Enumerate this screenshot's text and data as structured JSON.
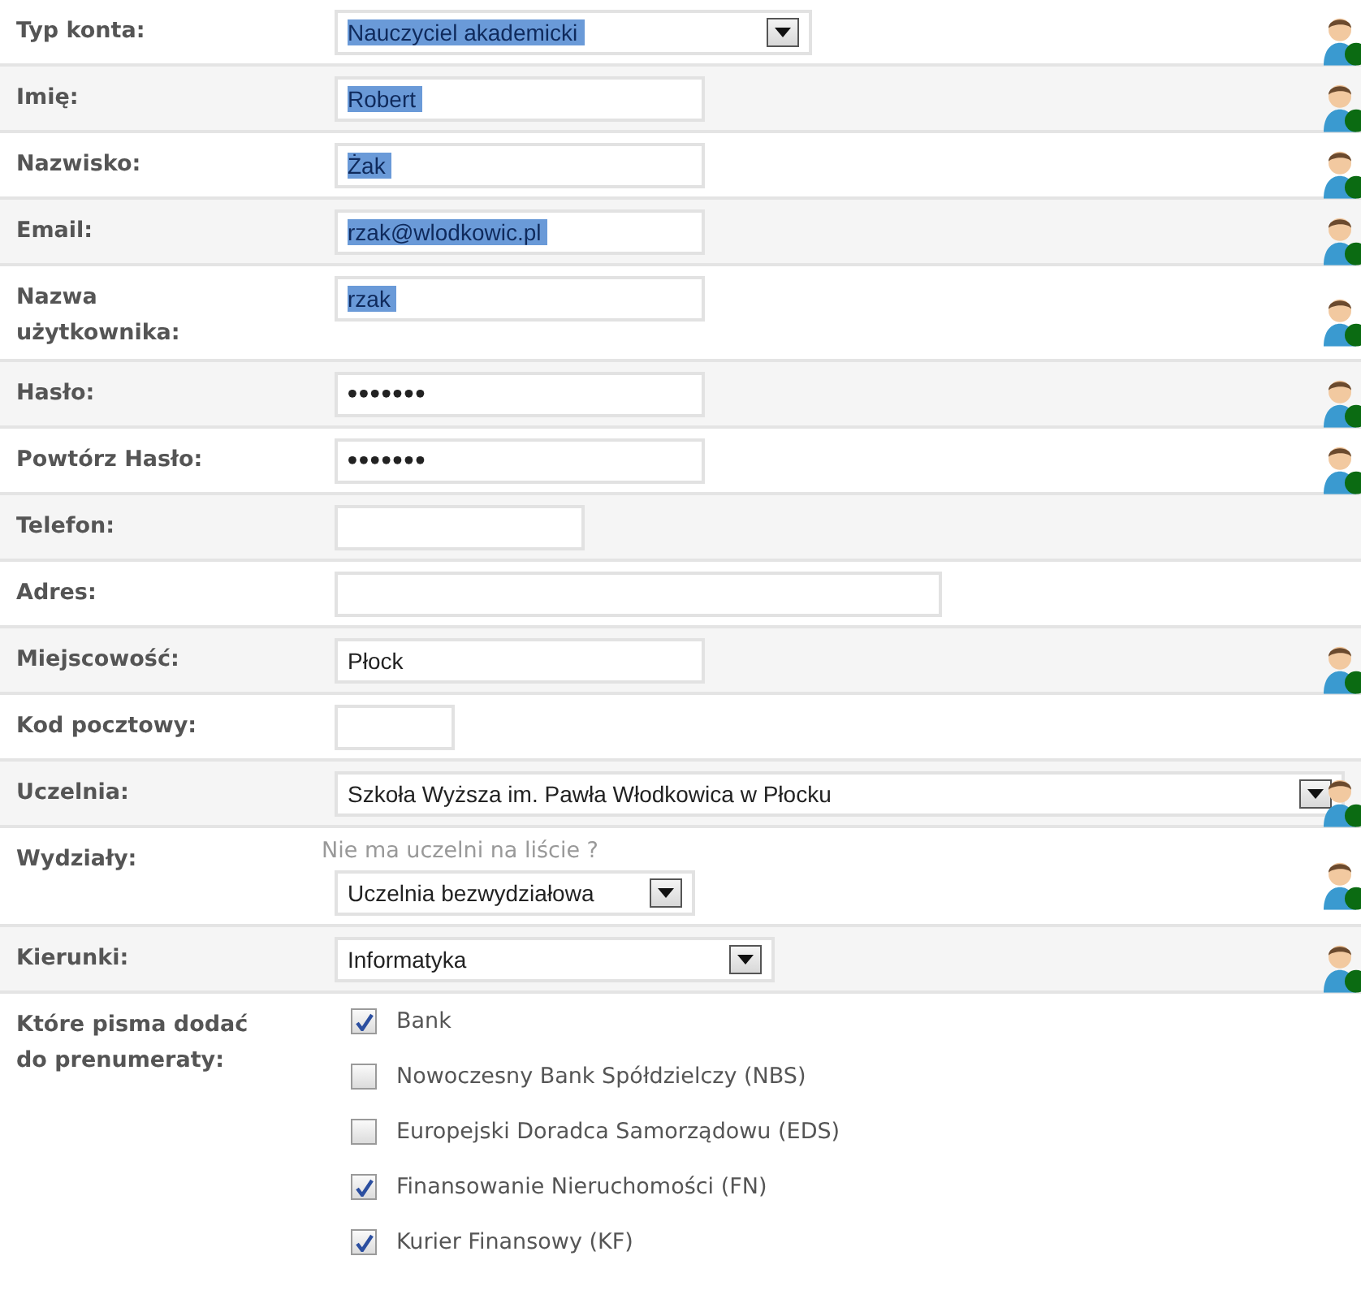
{
  "rows": [
    {
      "label": "Typ konta:",
      "kind": "select",
      "value": "Nauczyciel akademicki",
      "highlighted": true,
      "required": true
    },
    {
      "label": "Imię:",
      "kind": "text",
      "value": "Robert",
      "highlighted": true,
      "required": true
    },
    {
      "label": "Nazwisko:",
      "kind": "text",
      "value": "Żak",
      "highlighted": true,
      "required": true
    },
    {
      "label": "Email:",
      "kind": "text",
      "value": "rzak@wlodkowic.pl",
      "highlighted": true,
      "required": true
    },
    {
      "label": "Nazwa użytkownika:",
      "kind": "text",
      "value": "rzak",
      "highlighted": true,
      "required": true
    },
    {
      "label": "Hasło:",
      "kind": "password",
      "value": "•••••••",
      "highlighted": false,
      "required": true
    },
    {
      "label": "Powtórz Hasło:",
      "kind": "password",
      "value": "•••••••",
      "highlighted": false,
      "required": true
    },
    {
      "label": "Telefon:",
      "kind": "text",
      "required": false
    },
    {
      "label": "Adres:",
      "kind": "text",
      "required": false
    },
    {
      "label": "Miejscowość:",
      "kind": "text",
      "value": "Płock",
      "highlighted": false,
      "required": true
    },
    {
      "label": "Kod pocztowy:",
      "kind": "text",
      "required": false
    },
    {
      "label": "Uczelnia:",
      "kind": "select",
      "value": "Szkoła Wyższa im. Pawła Włodkowica w Płocku",
      "highlighted": false,
      "required": true
    },
    {
      "label": "Wydziały:",
      "kind": "select",
      "value": "Uczelnia bezwydziałowa",
      "hint": "Nie ma uczelni na liście ?",
      "highlighted": false,
      "required": true
    },
    {
      "label": "Kierunki:",
      "kind": "select",
      "value": "Informatyka",
      "highlighted": false,
      "required": true
    }
  ],
  "subscriptions": {
    "label": "Które pisma dodać do prenumeraty:",
    "options": [
      {
        "label": "Bank",
        "checked": true
      },
      {
        "label": "Nowoczesny Bank Spółdzielczy (NBS)",
        "checked": false
      },
      {
        "label": "Europejski Doradca Samorządowu (EDS)",
        "checked": false
      },
      {
        "label": "Finansowanie Nieruchomości (FN)",
        "checked": true
      },
      {
        "label": "Kurier Finansowy (KF)",
        "checked": true
      }
    ]
  }
}
